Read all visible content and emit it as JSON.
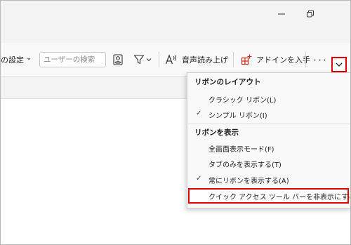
{
  "ribbon": {
    "settings_label": "の設定",
    "settings_chevron": "⌄",
    "search_placeholder": "ユーザーの検索",
    "read_aloud_label": "音声読み上げ",
    "addins_label": "アドインを入手",
    "more_label": "・・・"
  },
  "menu": {
    "layout_header": "リボンのレイアウト",
    "classic_label": "クラシック リボン(L)",
    "simple_label": "シンプル リボン(I)",
    "show_header": "リボンを表示",
    "fullscreen_label": "全画面表示モード(F)",
    "tabs_only_label": "タブのみを表示する(T)",
    "always_show_label": "常にリボンを表示する(A)",
    "hide_qat_label": "クイック アクセス ツール バーを非表示にする (H)",
    "check_mark": "✓"
  },
  "icons": {
    "minimize": "minimize-icon",
    "restore": "restore-icon",
    "contact": "contact-card-icon",
    "filter": "filter-icon",
    "read_aloud": "read-aloud-icon",
    "addins": "addins-icon",
    "collapse": "chevron-down-icon"
  },
  "colors": {
    "highlight_border": "#e00000",
    "addins_icon": "#c42b1c",
    "accent": "#0f6cbd"
  }
}
